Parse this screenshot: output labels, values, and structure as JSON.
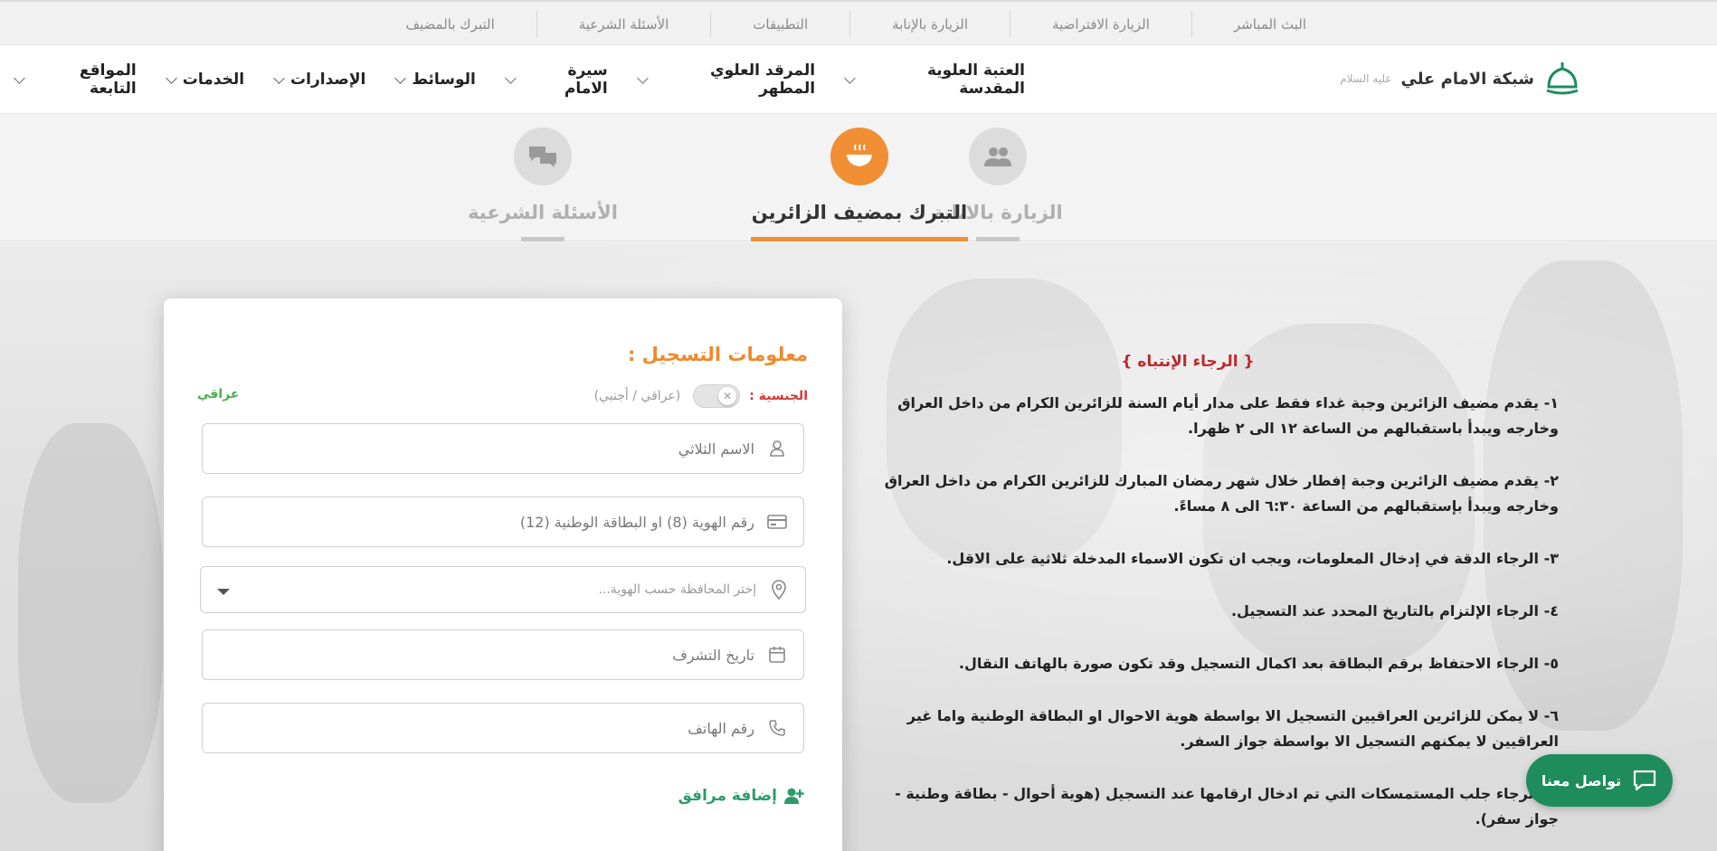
{
  "topbar": {
    "links": [
      "البث المباشر",
      "الزيارة الافتراضية",
      "الزيارة بالإنابة",
      "التطبيقات",
      "الأسئلة الشرعية",
      "التبرك بالمضيف"
    ]
  },
  "brand": {
    "name": "شبكة الامام علي",
    "subscript": "عليه السلام",
    "accent": "#1f8c5d"
  },
  "nav": {
    "items": [
      "العتبة العلوية المقدسة",
      "المرقد العلوي المطهر",
      "سيرة الامام",
      "الوسائط",
      "الإصدارات",
      "الخدمات",
      "المواقع التابعة"
    ]
  },
  "tabs": [
    {
      "label": "الزيارة بالانابة",
      "icon": "users-icon",
      "active": false
    },
    {
      "label": "التبرك بمضيف الزائرين",
      "icon": "food-bowl-icon",
      "active": true
    },
    {
      "label": "الأسئلة الشرعية",
      "icon": "chat-icon",
      "active": false
    }
  ],
  "form": {
    "title": "معلومات التسجيل :",
    "nationality_label": "الجنسية :",
    "nationality_hint": "(عراقي / أجنبي)",
    "nationality_value": "عراقي",
    "full_name_placeholder": "الاسم الثلاثي",
    "id_placeholder": "رقم الهوية (8) او البطاقة الوطنية (12)",
    "province_placeholder": "إختر المحافظة حسب الهوية...",
    "date_placeholder": "تاريخ التشرف",
    "phone_placeholder": "رقم الهاتف",
    "add_companion": "إضافة مرافق"
  },
  "notice": {
    "title": "{ الرجاء الإنتباه }",
    "items": [
      "١- يقدم مضيف الزائرين وجبة غداء فقط على مدار أيام السنة للزائرين الكرام من داخل العراق وخارجه ويبدأ باستقبالهم من الساعة ١٢ الى ٢ ظهرا.",
      "٢- يقدم مضيف الزائرين وجبة إفطار خلال شهر رمضان المبارك للزائرين الكرام من داخل العراق وخارجه ويبدأ بإستقبالهم من الساعة ٦:٣٠ الى ٨ مساءً.",
      "٣- الرجاء الدقة في إدخال المعلومات، ويجب ان تكون الاسماء المدخلة ثلاثية على الاقل.",
      "٤- الرجاء الإلتزام بالتاريخ المحدد عند التسجيل.",
      "٥- الرجاء الاحتفاظ برقم البطاقة بعد اكمال التسجيل وقد تكون صورة بالهاتف النقال.",
      "٦- لا يمكن للزائرين العراقيين التسجيل الا بواسطة هوية الاحوال او البطاقة الوطنية واما غير العراقيين لا يمكنهم التسجيل الا بواسطة جواز السفر.",
      "٧- الرجاء جلب المستمسكات التي تم ادخال ارقامها عند التسجيل (هوية أحوال - بطاقة وطنية - جواز سفر)."
    ]
  },
  "contact": {
    "label": "تواصل معنا",
    "icon": "chat-bubble-icon"
  },
  "colors": {
    "orange": "#f08f34",
    "green": "#1f8c5d",
    "red": "#c0282d"
  }
}
